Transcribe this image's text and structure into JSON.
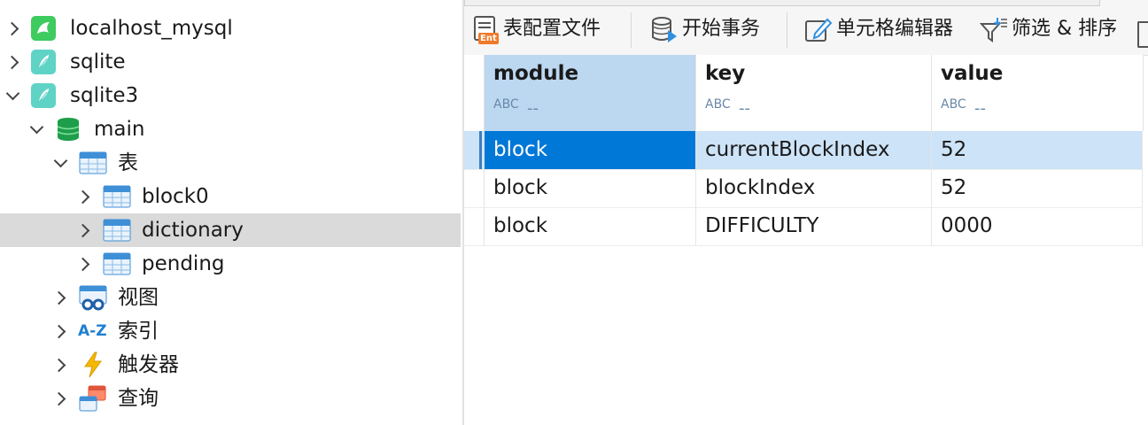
{
  "tree": {
    "items": [
      {
        "label": "localhost_mysql"
      },
      {
        "label": "sqlite"
      },
      {
        "label": "sqlite3"
      },
      {
        "label": "main"
      },
      {
        "label": "表"
      },
      {
        "label": "block0"
      },
      {
        "label": "dictionary"
      },
      {
        "label": "pending"
      },
      {
        "label": "视图"
      },
      {
        "label": "索引"
      },
      {
        "label": "触发器"
      },
      {
        "label": "查询"
      }
    ],
    "index_icon_text": "A-Z"
  },
  "toolbar": {
    "config_label": "表配置文件",
    "ent_badge": "Ent",
    "transaction_label": "开始事务",
    "cell_editor_label": "单元格编辑器",
    "filter_sort_label": "筛选 & 排序"
  },
  "grid": {
    "columns": [
      {
        "name": "module",
        "type": "ABC",
        "dash": "--"
      },
      {
        "name": "key",
        "type": "ABC",
        "dash": "--"
      },
      {
        "name": "value",
        "type": "ABC",
        "dash": "--"
      }
    ],
    "rows": [
      [
        "block",
        "currentBlockIndex",
        "52"
      ],
      [
        "block",
        "blockIndex",
        "52"
      ],
      [
        "block",
        "DIFFICULTY",
        "0000"
      ]
    ]
  },
  "colors": {
    "selection_blue": "#0078d7",
    "row_highlight": "#cde3f7",
    "header_selected": "#bcd7f0",
    "tree_selected": "#dadada",
    "sqlite_icon": "#5fd3c6",
    "mysql_icon": "#3ecb5f"
  }
}
